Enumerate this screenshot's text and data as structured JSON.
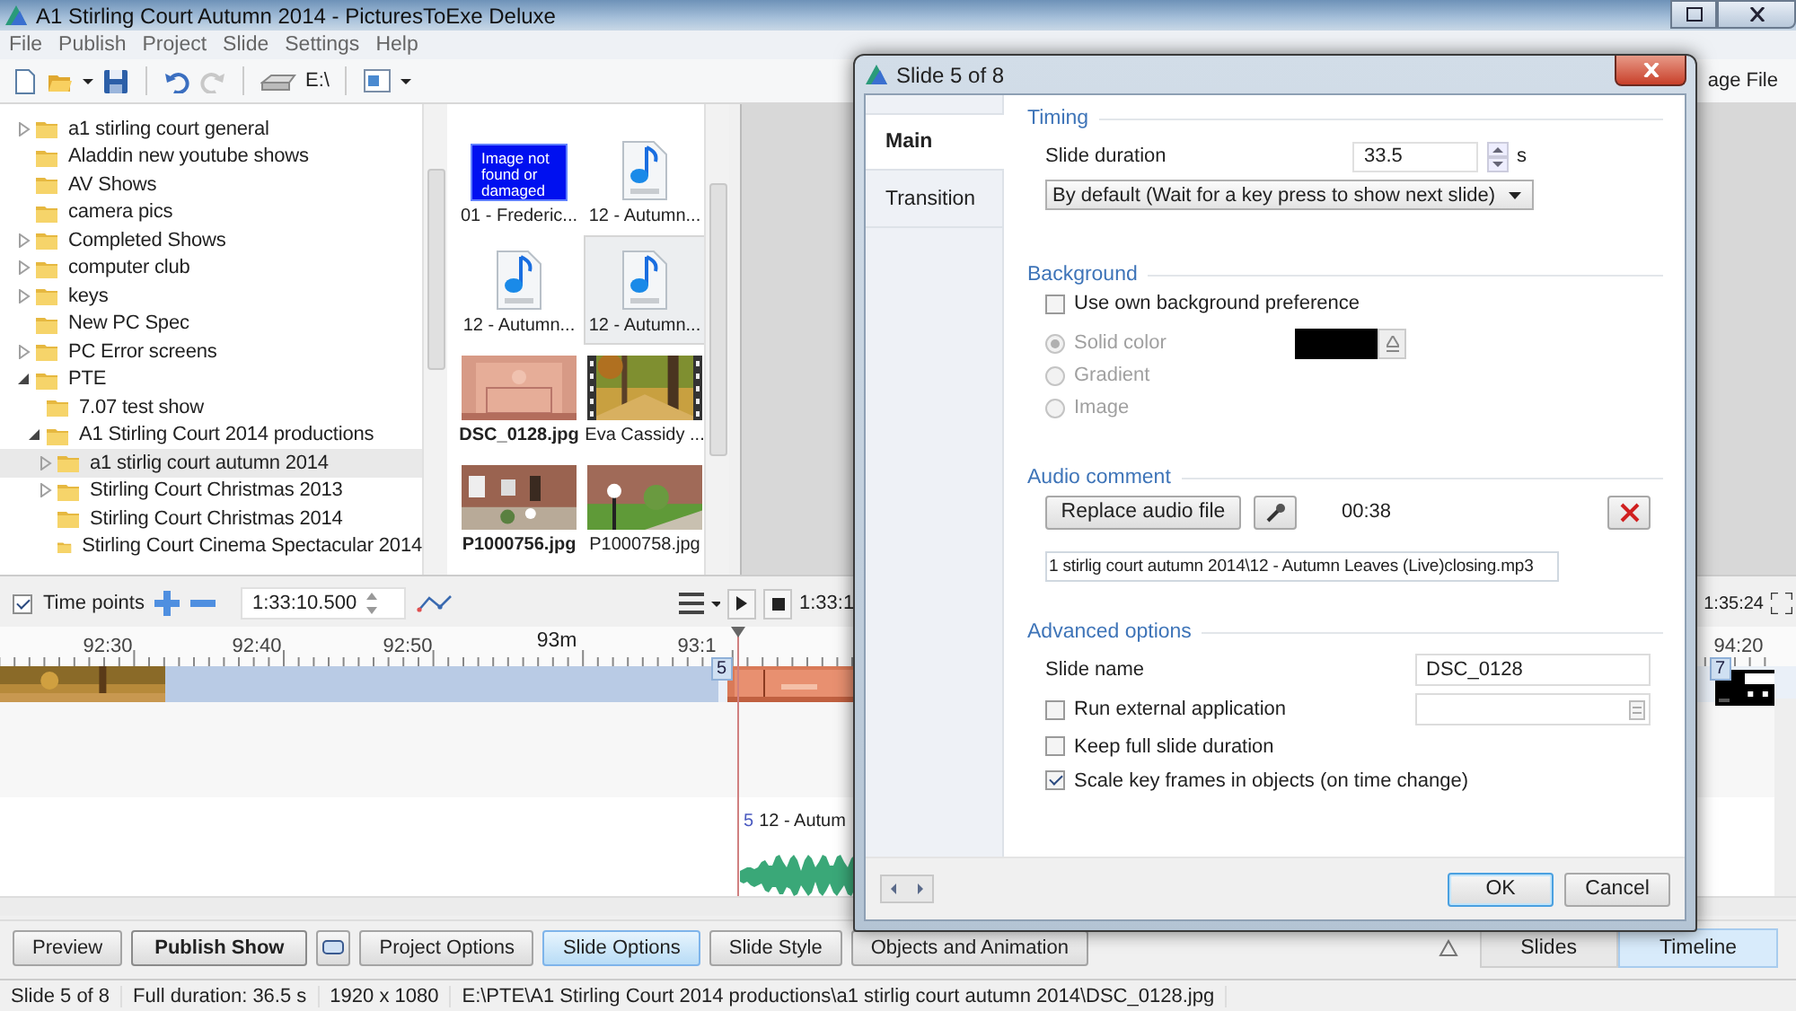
{
  "window": {
    "title": "A1 Stirling Court Autumn 2014 - PicturesToExe Deluxe"
  },
  "menu": [
    "File",
    "Publish",
    "Project",
    "Slide",
    "Settings",
    "Help"
  ],
  "toolbar": {
    "drive": "E:\\",
    "cut_button": "age File"
  },
  "folders": [
    {
      "label": "a1 stirling court general",
      "expanded": false,
      "selected": false
    },
    {
      "label": "Aladdin new youtube shows",
      "selected": false
    },
    {
      "label": "AV Shows",
      "selected": false
    },
    {
      "label": "camera pics",
      "selected": false
    },
    {
      "label": "Completed Shows",
      "expanded": false,
      "selected": false
    },
    {
      "label": "computer club",
      "expanded": false,
      "selected": false
    },
    {
      "label": "keys",
      "expanded": false,
      "selected": false
    },
    {
      "label": "New PC Spec",
      "selected": false
    },
    {
      "label": "PC Error screens",
      "expanded": false,
      "selected": false
    },
    {
      "label": "PTE",
      "expanded": true,
      "selected": false,
      "children": [
        {
          "label": "7.07 test show",
          "selected": false
        },
        {
          "label": "A1 Stirling Court 2014 productions",
          "expanded": true,
          "selected": false,
          "children": [
            {
              "label": "a1 stirlig court autumn 2014",
              "expanded": false,
              "selected": true
            },
            {
              "label": "Stirling Court Christmas 2013",
              "expanded": false,
              "selected": false
            },
            {
              "label": "Stirling Court Christmas 2014",
              "selected": false
            },
            {
              "label": "Stirling Court Cinema Spectacular 2014",
              "selected": false
            }
          ]
        }
      ]
    }
  ],
  "files": [
    {
      "name": "01 - Frederic...",
      "kind": "missing",
      "message": "Image not found or damaged",
      "used": false,
      "selected": false
    },
    {
      "name": "12 - Autumn...",
      "kind": "audio",
      "used": false,
      "selected": false
    },
    {
      "name": "12 - Autumn...",
      "kind": "audio",
      "used": false,
      "selected": false
    },
    {
      "name": "12 - Autumn...",
      "kind": "audio",
      "used": false,
      "selected": true
    },
    {
      "name": "DSC_0128.jpg",
      "used": true,
      "selected": false
    },
    {
      "name": "Eva Cassidy ...",
      "kind": "video",
      "used": false,
      "selected": false
    },
    {
      "name": "P1000756.jpg",
      "used": true,
      "selected": false
    },
    {
      "name": "P1000758.jpg",
      "used": false,
      "selected": false
    }
  ],
  "timeline": {
    "time_points": {
      "label": "Time points",
      "checked": true
    },
    "position": "1:33:10.500",
    "play_time": "1:33:1",
    "end_time": "1:35:24",
    "ruler_labels": [
      "92:30",
      "92:40",
      "92:50",
      "93m",
      "93:1",
      "94:20"
    ],
    "slide_markers": [
      "5",
      "7"
    ],
    "audio": {
      "slide": "5",
      "name": "12 - Autum"
    }
  },
  "buttons": [
    {
      "label": "Preview",
      "kind": "text",
      "primary": false,
      "selected": false
    },
    {
      "label": "Publish Show",
      "kind": "text",
      "primary": true,
      "selected": false
    },
    {
      "kind": "icon",
      "primary": false,
      "selected": false
    },
    {
      "label": "Project Options",
      "kind": "text",
      "primary": false,
      "selected": false
    },
    {
      "label": "Slide Options",
      "kind": "text",
      "primary": false,
      "selected": true
    },
    {
      "label": "Slide Style",
      "kind": "text",
      "primary": false,
      "selected": false
    },
    {
      "label": "Objects and Animation",
      "kind": "text",
      "primary": false,
      "selected": false
    }
  ],
  "view_tabs": [
    {
      "label": "Slides",
      "selected": false
    },
    {
      "label": "Timeline",
      "selected": true
    }
  ],
  "status_bar": [
    "Slide 5 of 8",
    "Full duration: 36.5 s",
    "1920 x 1080",
    "E:\\PTE\\A1 Stirling Court 2014 productions\\a1 stirlig court autumn 2014\\DSC_0128.jpg"
  ],
  "dialog": {
    "title": "Slide 5 of 8",
    "tabs": [
      {
        "label": "Main",
        "selected": true
      },
      {
        "label": "Transition",
        "selected": false
      }
    ],
    "timing": {
      "heading": "Timing",
      "duration_label": "Slide duration",
      "duration": "33.5",
      "unit": "s",
      "mode": "By default (Wait for a key press to show next slide)"
    },
    "background": {
      "heading": "Background",
      "use_own": {
        "label": "Use own background preference",
        "checked": false
      },
      "options": [
        {
          "label": "Solid color",
          "selected": true
        },
        {
          "label": "Gradient",
          "selected": false
        },
        {
          "label": "Image",
          "selected": false
        }
      ],
      "color": "#000000"
    },
    "audio": {
      "heading": "Audio comment",
      "replace": "Replace audio file",
      "length": "00:38",
      "file": "1 stirlig court autumn 2014\\12 - Autumn Leaves (Live)closing.mp3"
    },
    "advanced": {
      "heading": "Advanced options",
      "name_label": "Slide name",
      "name": "DSC_0128",
      "options": [
        {
          "label": "Run external application",
          "kind": "field",
          "checked": false
        },
        {
          "label": "Keep full slide duration",
          "kind": "plain",
          "checked": false
        },
        {
          "label": "Scale key frames in objects (on time change)",
          "kind": "plain",
          "checked": true
        }
      ]
    },
    "ok": "OK",
    "cancel": "Cancel"
  }
}
